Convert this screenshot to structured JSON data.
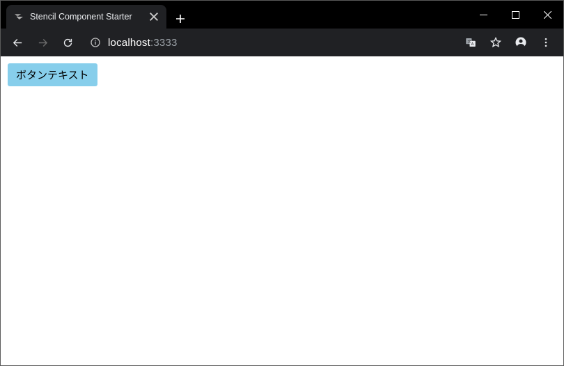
{
  "window": {
    "tab_title": "Stencil Component Starter"
  },
  "address": {
    "host": "localhost",
    "port": ":3333"
  },
  "page": {
    "button_label": "ボタンテキスト"
  }
}
